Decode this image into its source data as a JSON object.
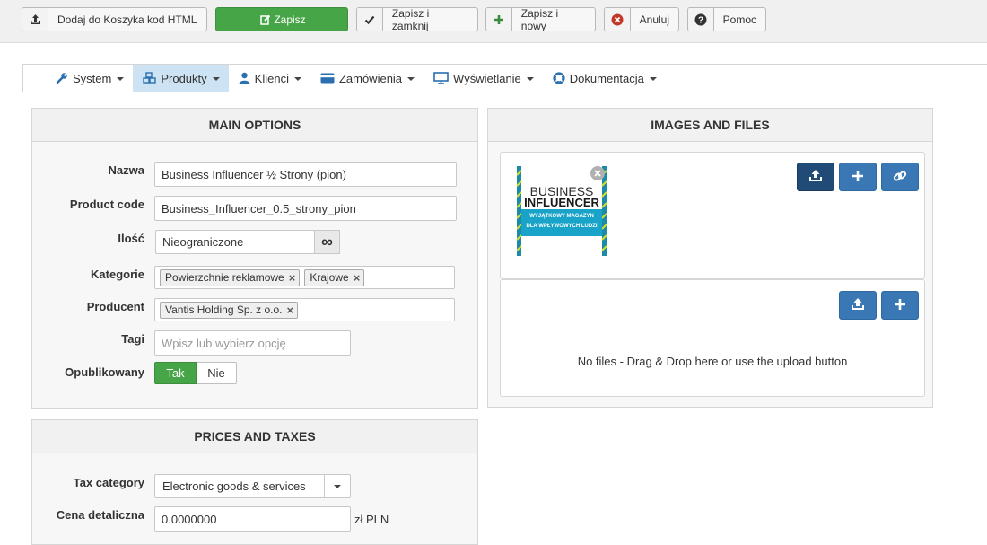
{
  "toolbar": {
    "add_cart_html": "Dodaj do Koszyka kod HTML",
    "save": "Zapisz",
    "save_close": "Zapisz i zamknij",
    "save_new": "Zapisz i nowy",
    "cancel": "Anuluj",
    "help": "Pomoc"
  },
  "menu": [
    {
      "label": "System",
      "icon": "wrench-icon"
    },
    {
      "label": "Produkty",
      "icon": "cubes-icon",
      "active": true
    },
    {
      "label": "Klienci",
      "icon": "user-icon"
    },
    {
      "label": "Zamówienia",
      "icon": "credit-card-icon"
    },
    {
      "label": "Wyświetlanie",
      "icon": "monitor-icon"
    },
    {
      "label": "Dokumentacja",
      "icon": "life-ring-icon"
    }
  ],
  "main_options": {
    "title": "MAIN OPTIONS",
    "name_label": "Nazwa",
    "name_value": "Business Influencer ½ Strony (pion)",
    "code_label": "Product code",
    "code_value": "Business_Influencer_0.5_strony_pion",
    "qty_label": "Ilość",
    "qty_value": "Nieograniczone",
    "qty_infinite": "∞",
    "categories_label": "Kategorie",
    "categories": [
      "Powierzchnie reklamowe",
      "Krajowe"
    ],
    "producer_label": "Producent",
    "producer": [
      "Vantis Holding Sp. z o.o."
    ],
    "tags_label": "Tagi",
    "tags_placeholder": "Wpisz lub wybierz opcję",
    "published_label": "Opublikowany",
    "published_yes": "Tak",
    "published_no": "Nie",
    "published": true
  },
  "prices": {
    "title": "PRICES AND TAXES",
    "tax_label": "Tax category",
    "tax_value": "Electronic goods & services",
    "retail_label": "Cena detaliczna",
    "retail_value": "0.0000000",
    "currency": "zł PLN"
  },
  "images": {
    "title": "IMAGES AND FILES",
    "thumb_text_1": "BUSINESS",
    "thumb_text_2": "INFLUENCER",
    "thumb_text_3": "WYJĄTKOWY MAGAZYN",
    "thumb_text_4": "DLA WPŁYWOWYCH LUDZI",
    "no_files": "No files - Drag & Drop here or use the upload button"
  },
  "colors": {
    "green": "#46a546",
    "blue": "#3a78b5",
    "blue_dark": "#1f4b76",
    "menu_active": "#cde3f3"
  }
}
